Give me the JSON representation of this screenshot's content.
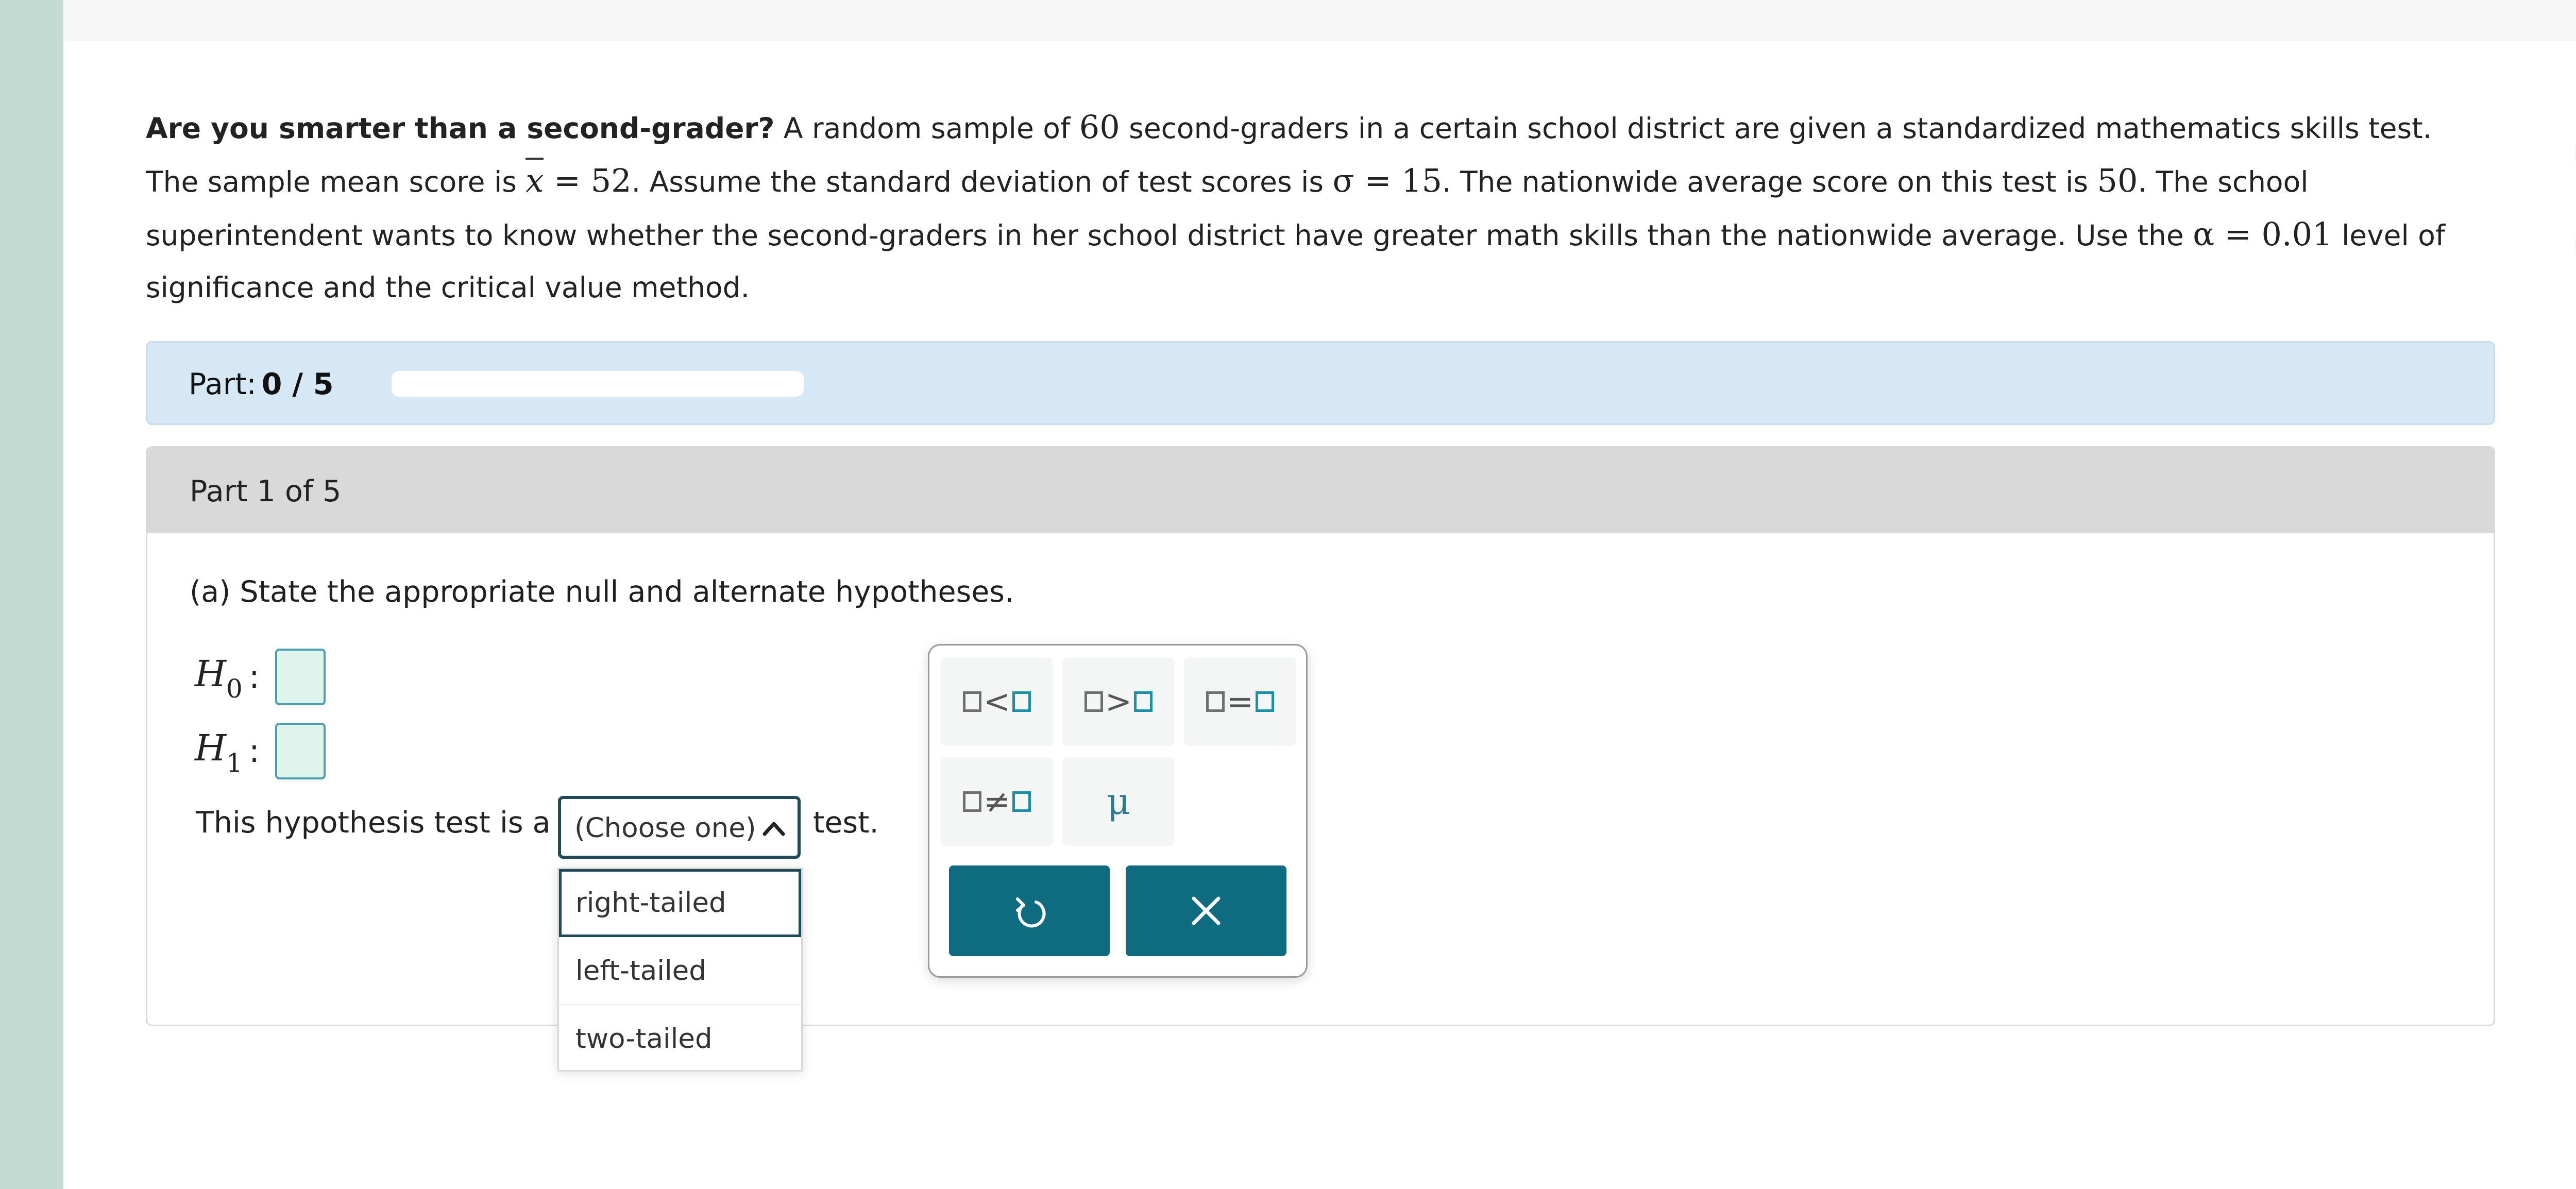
{
  "question": {
    "title": "Are you smarter than a second-grader?",
    "t1": " A random sample of ",
    "n": "60",
    "t2": " second-graders in a certain school district are given a standardized mathematics skills test. The sample mean score is ",
    "xbar_symbol": "x",
    "eq1": " = 52",
    "t3": ". Assume the standard deviation of test scores is ",
    "sigma_expr": "σ = 15",
    "t4": ". The nationwide average score on this test is ",
    "mu0": "50",
    "t5": ". The school superintendent wants to know whether the second-graders in her school district have greater math skills than the nationwide average. Use the ",
    "alpha_expr": "α = 0.01",
    "t6": " level of significance and the critical value method."
  },
  "progress": {
    "label": "Part:",
    "value": "0 / 5",
    "fraction": 0
  },
  "part": {
    "header": "Part 1 of 5",
    "instruction": "(a) State the appropriate null and alternate hypotheses.",
    "h0_letter": "H",
    "h0_sub": "0",
    "h1_letter": "H",
    "h1_sub": "1",
    "colon": ":",
    "test_prefix": "This hypothesis test is a",
    "test_suffix": "test.",
    "select_value": "(Choose one)",
    "options": [
      "right-tailed",
      "left-tailed",
      "two-tailed"
    ]
  },
  "palette": {
    "lt": "<",
    "gt": ">",
    "eq": "=",
    "ne": "≠",
    "mu": "μ"
  },
  "colors": {
    "accent": "#0e6b80",
    "answer_box_fill": "#def4ed",
    "answer_box_border": "#4f9fb0",
    "progress_bg": "#d6e7f5",
    "left_strip": "#c3dbd3"
  },
  "icons": {
    "tool_1": "bar-chart-icon",
    "tool_2": "calculator-icon",
    "select_chevron": "chevron-up-icon",
    "undo": "undo-icon",
    "clear": "close-icon"
  }
}
